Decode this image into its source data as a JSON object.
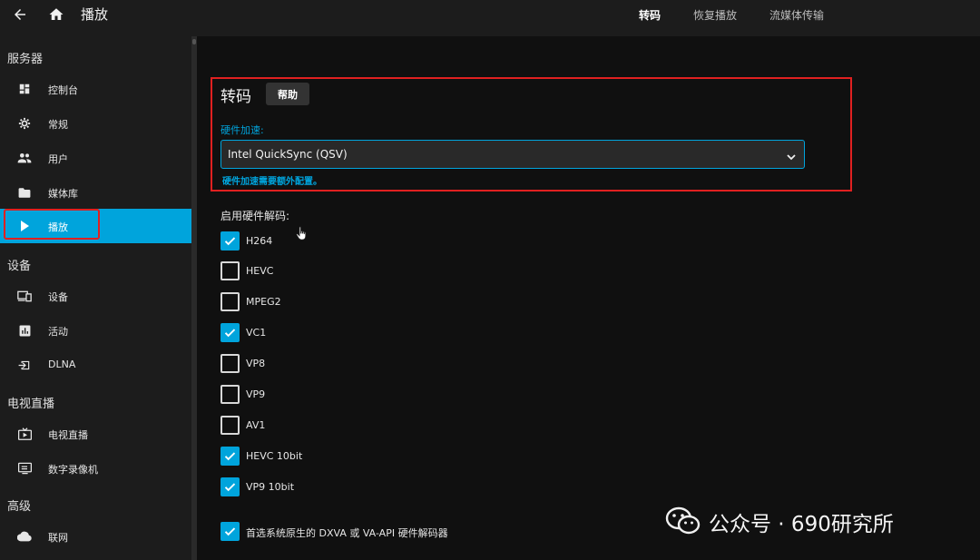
{
  "header": {
    "title": "播放",
    "tabs": [
      {
        "label": "转码",
        "active": true
      },
      {
        "label": "恢复播放",
        "active": false
      },
      {
        "label": "流媒体传输",
        "active": false
      }
    ]
  },
  "sidebar": {
    "sections": [
      {
        "title": "服务器",
        "items": [
          {
            "label": "控制台",
            "icon": "dashboard-icon"
          },
          {
            "label": "常规",
            "icon": "gear-icon"
          },
          {
            "label": "用户",
            "icon": "people-icon"
          },
          {
            "label": "媒体库",
            "icon": "folder-icon"
          },
          {
            "label": "播放",
            "icon": "play-icon",
            "active": true
          }
        ]
      },
      {
        "title": "设备",
        "items": [
          {
            "label": "设备",
            "icon": "devices-icon"
          },
          {
            "label": "活动",
            "icon": "activity-icon"
          },
          {
            "label": "DLNA",
            "icon": "input-icon"
          }
        ]
      },
      {
        "title": "电视直播",
        "items": [
          {
            "label": "电视直播",
            "icon": "live-tv-icon"
          },
          {
            "label": "数字录像机",
            "icon": "dvr-icon"
          }
        ]
      },
      {
        "title": "高级",
        "items": [
          {
            "label": "联网",
            "icon": "cloud-icon"
          }
        ]
      }
    ]
  },
  "main": {
    "section_title": "转码",
    "help_label": "帮助",
    "hw_accel": {
      "label": "硬件加速:",
      "value": "Intel QuickSync (QSV)",
      "hint": "硬件加速需要额外配置。"
    },
    "codecs_label": "启用硬件解码:",
    "codecs": [
      {
        "label": "H264",
        "checked": true
      },
      {
        "label": "HEVC",
        "checked": false
      },
      {
        "label": "MPEG2",
        "checked": false
      },
      {
        "label": "VC1",
        "checked": true
      },
      {
        "label": "VP8",
        "checked": false
      },
      {
        "label": "VP9",
        "checked": false
      },
      {
        "label": "AV1",
        "checked": false
      },
      {
        "label": "HEVC 10bit",
        "checked": true
      },
      {
        "label": "VP9 10bit",
        "checked": true
      }
    ],
    "prefer_native": {
      "label": "首选系统原生的 DXVA 或 VA-API 硬件解码器",
      "checked": true
    }
  },
  "watermark": {
    "text": "公众号 · 690研究所"
  },
  "colors": {
    "accent": "#00a4dc",
    "highlight": "#e02020",
    "background": "#101010",
    "panel": "#1c1c1c"
  }
}
